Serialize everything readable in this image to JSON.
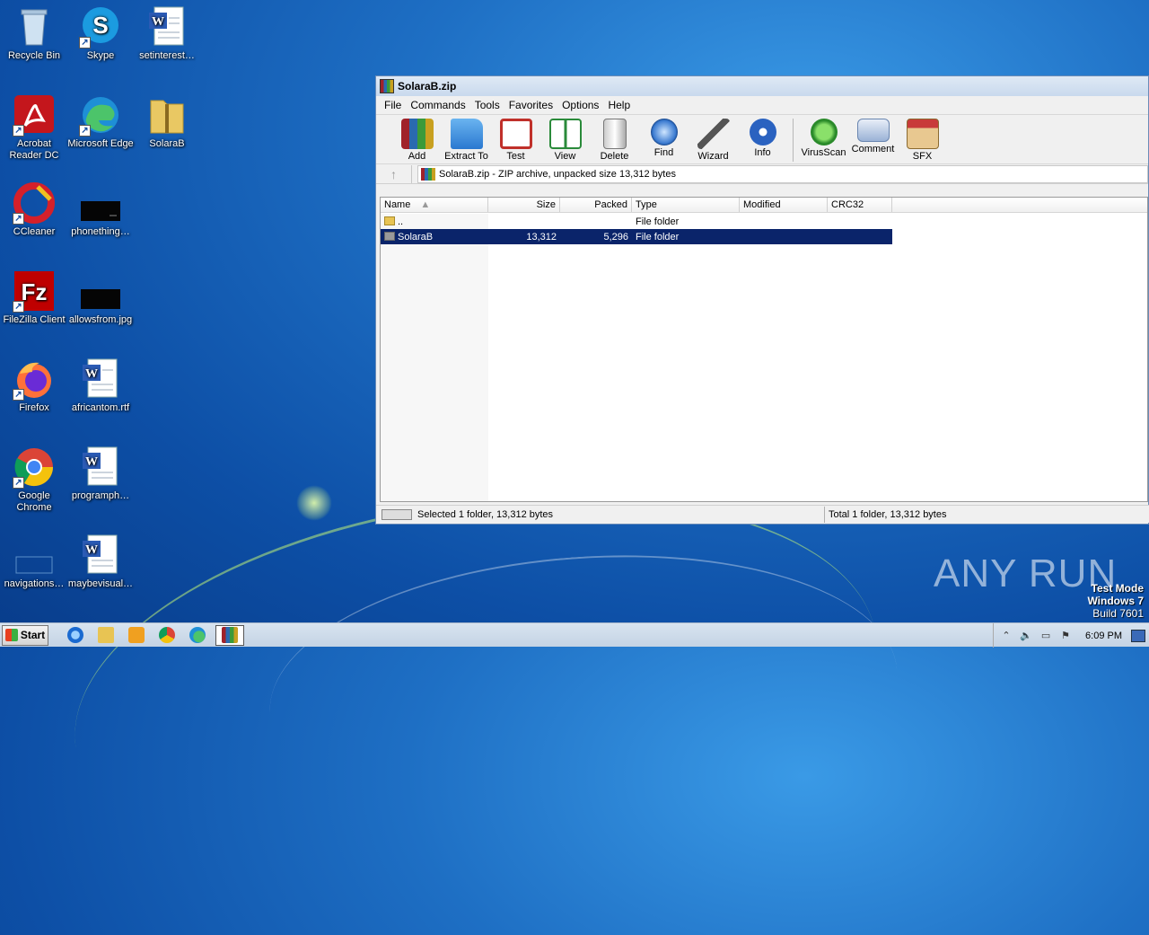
{
  "desktop": {
    "icons": [
      {
        "label": "Recycle Bin"
      },
      {
        "label": "Skype"
      },
      {
        "label": "setinterest…"
      },
      {
        "label": "Acrobat Reader DC"
      },
      {
        "label": "Microsoft Edge"
      },
      {
        "label": "SolaraB"
      },
      {
        "label": "CCleaner"
      },
      {
        "label": "phonething…"
      },
      {
        "label": "FileZilla Client"
      },
      {
        "label": "allowsfrom.jpg"
      },
      {
        "label": "Firefox"
      },
      {
        "label": "africantom.rtf"
      },
      {
        "label": "Google Chrome"
      },
      {
        "label": "programph…"
      },
      {
        "label": "navigations…"
      },
      {
        "label": "maybevisual…"
      }
    ]
  },
  "window": {
    "title": "SolaraB.zip",
    "menu": [
      "File",
      "Commands",
      "Tools",
      "Favorites",
      "Options",
      "Help"
    ],
    "toolbar": [
      "Add",
      "Extract To",
      "Test",
      "View",
      "Delete",
      "Find",
      "Wizard",
      "Info",
      "VirusScan",
      "Comment",
      "SFX"
    ],
    "address": "SolaraB.zip - ZIP archive, unpacked size 13,312 bytes",
    "columns": [
      "Name",
      "Size",
      "Packed",
      "Type",
      "Modified",
      "CRC32"
    ],
    "rows": [
      {
        "name": "..",
        "size": "",
        "packed": "",
        "type": "File folder",
        "modified": "",
        "crc": ""
      },
      {
        "name": "SolaraB",
        "size": "13,312",
        "packed": "5,296",
        "type": "File folder",
        "modified": "",
        "crc": ""
      }
    ],
    "status_left": "Selected 1 folder, 13,312 bytes",
    "status_right": "Total 1 folder, 13,312 bytes"
  },
  "taskbar": {
    "start_label": "Start",
    "clock": "6:09 PM"
  },
  "watermark": "ANY RUN",
  "testmode": {
    "line1": "Test Mode",
    "line2": "Windows 7",
    "line3": "Build 7601"
  },
  "colors": {
    "selection": "#0a246a",
    "desktop": "#1e6fc4"
  }
}
